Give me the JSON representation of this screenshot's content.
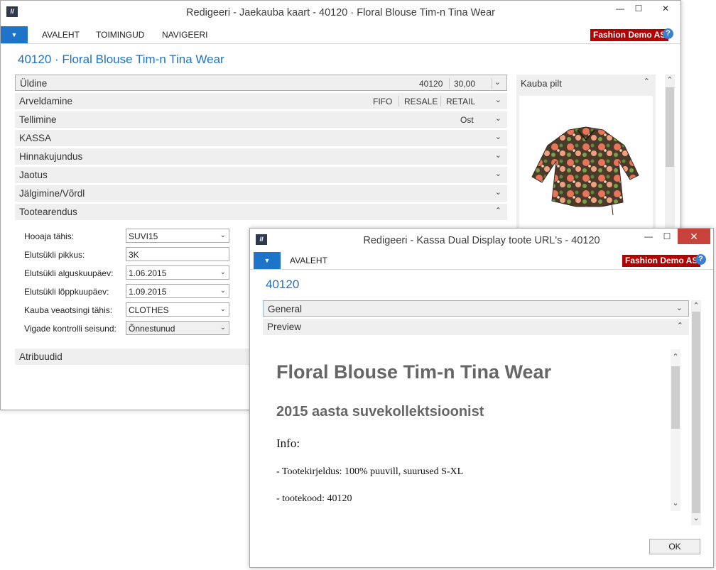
{
  "main_window": {
    "title": "Redigeeri - Jaekauba kaart - 40120 · Floral Blouse Tim-n Tina Wear",
    "logo_text": "ll",
    "nav_tabs": [
      "AVALEHT",
      "TOIMINGUD",
      "NAVIGEERI"
    ],
    "company": "Fashion Demo AS",
    "page_title": "40120 · Floral Blouse Tim-n Tina Wear",
    "fasttabs": {
      "uldine": {
        "label": "Üldine",
        "values": [
          "40120",
          "30,00"
        ]
      },
      "arveldamine": {
        "label": "Arveldamine",
        "values": [
          "FIFO",
          "RESALE",
          "RETAIL"
        ]
      },
      "tellimine": {
        "label": "Tellimine",
        "values": [
          "Ost"
        ]
      },
      "kassa": {
        "label": "KASSA"
      },
      "hinnakujundus": {
        "label": "Hinnakujundus"
      },
      "jaotus": {
        "label": "Jaotus"
      },
      "jalgimine": {
        "label": "Jälgimine/Võrdl"
      },
      "tootearendus": {
        "label": "Tootearendus"
      },
      "atribuudid": {
        "label": "Atribuudid"
      }
    },
    "fields": [
      {
        "label": "Hooaja tähis:",
        "value": "SUVI15",
        "dropdown": true
      },
      {
        "label": "Elutsükli pikkus:",
        "value": "3K",
        "dropdown": false
      },
      {
        "label": "Elutsükli alguskuupäev:",
        "value": "1.06.2015",
        "dropdown": true
      },
      {
        "label": "Elutsükli lõppkuupäev:",
        "value": "1.09.2015",
        "dropdown": true
      },
      {
        "label": "Kauba veaotsingi tähis:",
        "value": "CLOTHES",
        "dropdown": true
      },
      {
        "label": "Vigade kontrolli seisund:",
        "value": "Õnnestunud",
        "dropdown": true
      }
    ],
    "factbox": {
      "title": "Kauba pilt"
    }
  },
  "popup_window": {
    "title": "Redigeeri - Kassa Dual Display toote URL's - 40120",
    "logo_text": "ll",
    "nav_tabs": [
      "AVALEHT"
    ],
    "company": "Fashion Demo AS",
    "page_title": "40120",
    "fasttabs": {
      "general": {
        "label": "General"
      },
      "preview": {
        "label": "Preview"
      }
    },
    "preview": {
      "heading1": "Floral Blouse Tim-n Tina Wear",
      "heading2": "2015 aasta suvekollektsioonist",
      "info_label": "Info:",
      "line1": "- Tootekirjeldus: 100% puuvill, suurused S-XL",
      "line2": "- tootekood: 40120"
    },
    "ok_button": "OK"
  },
  "colors": {
    "accent_blue": "#1f72c4",
    "menu_blue": "#1d74c9",
    "company_red": "#b30000",
    "close_red": "#c7423b"
  }
}
